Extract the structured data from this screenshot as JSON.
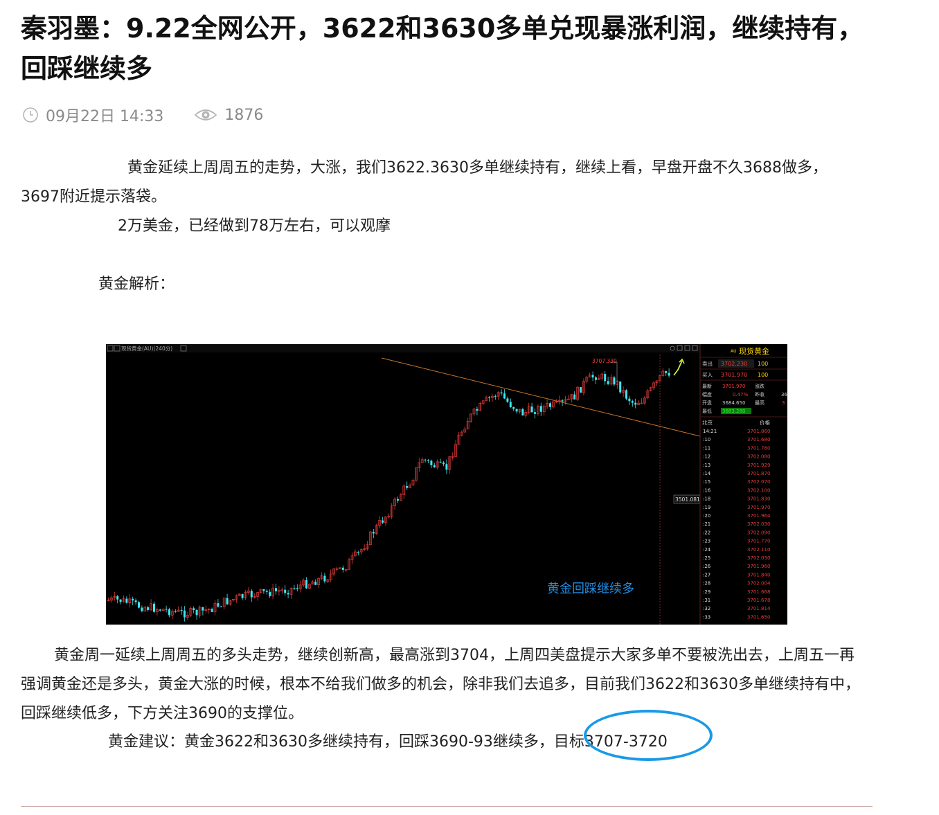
{
  "article": {
    "title": "秦羽墨：9.22全网公开，3622和3630多单兑现暴涨利润，继续持有，回踩继续多",
    "date": "09月22日 14:33",
    "views": "1876",
    "p1": "黄金延续上周周五的走势，大涨，我们3622.3630多单继续持有，继续上看，早盘开盘不久3688做多，3697附近提示落袋。",
    "p2": "2万美金，已经做到78万左右，可以观摩",
    "p3": "黄金解析：",
    "p4": "黄金周一延续上周周五的多头走势，继续创新高，最高涨到3704，上周四美盘提示大家多单不要被洗出去，上周五一再强调黄金还是多头，黄金大涨的时候，根本不给我们做多的机会，除非我们去追多，目前我们3622和3630多单继续持有中，回踩继续低多，下方关注3690的支撑位。",
    "p5": "黄金建议：黄金3622和3630多继续持有，回踩3690-93继续多，目标3707-3720"
  },
  "chart": {
    "header": "现货黄金(AU)(240分)",
    "peak_label": "3707.330",
    "price_tag": "3501.081",
    "overlay": "黄金回踩继续多",
    "panel": {
      "code": "AU",
      "name": "现货黄金",
      "ask_label": "卖出",
      "ask": "3702.230",
      "ask_vol": "100",
      "bid_label": "买入",
      "bid": "3701.970",
      "bid_vol": "100",
      "latest_label": "最新",
      "latest": "3701.970",
      "change_label": "涨跌",
      "change_val": "",
      "range_label": "幅度",
      "range": "0.47%",
      "prev_label": "昨收",
      "prev_val": "36",
      "open_label": "开盘",
      "open": "3684.650",
      "high_label": "最高",
      "high_val": "3",
      "low_label": "最低",
      "low": "3683.280",
      "time_col": "北京",
      "price_col": "价格",
      "ticks": [
        {
          "t": "14:21",
          "p": "3701.860"
        },
        {
          "t": ":10",
          "p": "3701.680"
        },
        {
          "t": ":11",
          "p": "3701.760"
        },
        {
          "t": ":12",
          "p": "3702.080"
        },
        {
          "t": ":13",
          "p": "3701.929"
        },
        {
          "t": ":14",
          "p": "3701.870"
        },
        {
          "t": ":15",
          "p": "3702.070"
        },
        {
          "t": ":16",
          "p": "3702.100"
        },
        {
          "t": ":18",
          "p": "3701.830"
        },
        {
          "t": ":19",
          "p": "3701.970"
        },
        {
          "t": ":20",
          "p": "3701.964"
        },
        {
          "t": ":21",
          "p": "3702.030"
        },
        {
          "t": ":22",
          "p": "3702.090"
        },
        {
          "t": ":23",
          "p": "3701.770"
        },
        {
          "t": ":24",
          "p": "3702.110"
        },
        {
          "t": ":25",
          "p": "3702.030"
        },
        {
          "t": ":26",
          "p": "3701.960"
        },
        {
          "t": ":27",
          "p": "3701.840"
        },
        {
          "t": ":28",
          "p": "3702.004"
        },
        {
          "t": ":29",
          "p": "3701.668"
        },
        {
          "t": ":31",
          "p": "3701.678"
        },
        {
          "t": ":32",
          "p": "3701.814"
        },
        {
          "t": ":33",
          "p": "3701.650"
        }
      ]
    }
  },
  "colors": {
    "up": "#e23b3b",
    "down": "#3de8f2",
    "trendline": "#c7762c",
    "overlay_text": "#1f8fe6",
    "circle": "#1a9ae6",
    "panel_gold": "#ffd700",
    "panel_green": "#20ff20"
  },
  "icons": [
    "clock-icon",
    "eye-icon",
    "arrow-up-icon"
  ]
}
